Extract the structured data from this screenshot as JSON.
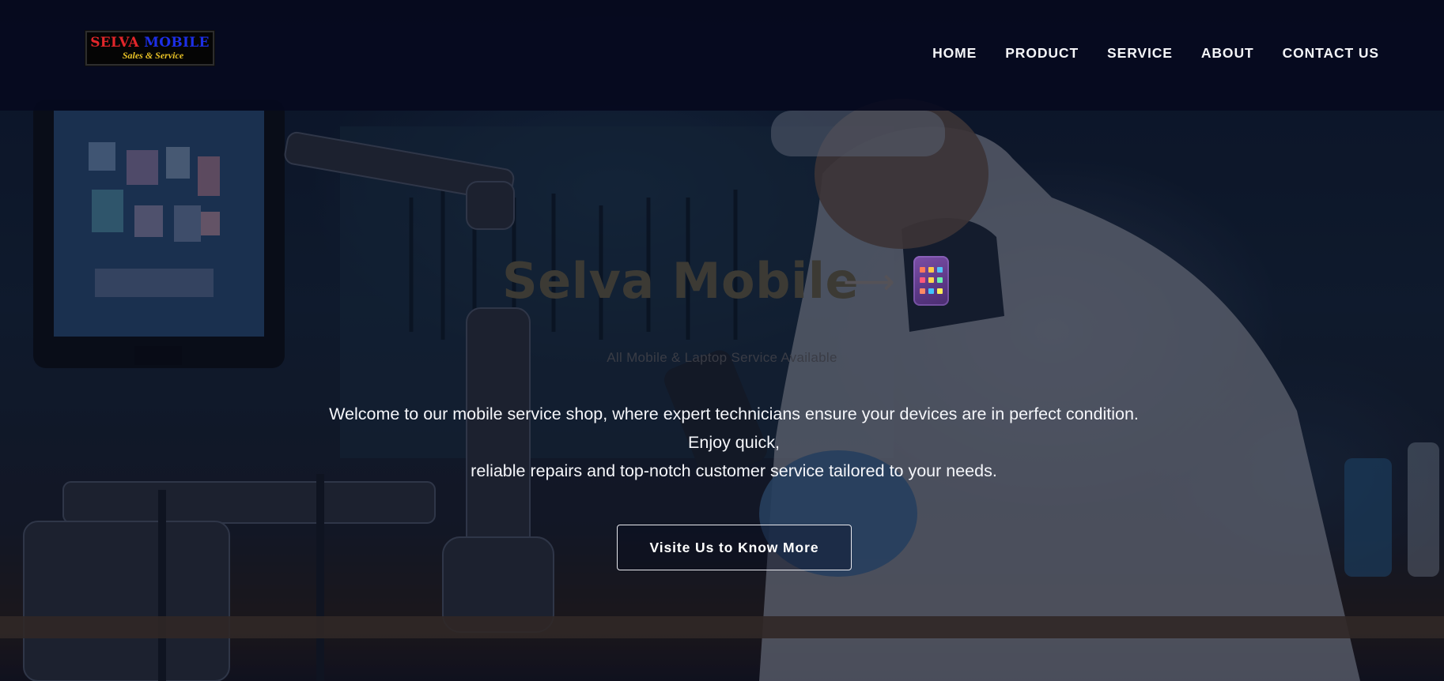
{
  "navbar": {
    "logo": {
      "line1_part1": "SELVA ",
      "line1_part2": "MOBILE",
      "line2": "Sales & Service",
      "colors": {
        "selva": "#e2262a",
        "mobile": "#1d2fe6",
        "tagline": "#e9c226"
      }
    },
    "links": [
      "HOME",
      "PRODUCT",
      "SERVICE",
      "ABOUT",
      "CONTACT US"
    ]
  },
  "hero": {
    "title": "Selva Mobile",
    "arrow": "⟶",
    "icon": "mobile-phone-icon",
    "subtitle": "All Mobile & Laptop Service Available",
    "description_line1": "Welcome to our mobile service shop, where expert technicians ensure your devices are in perfect condition. Enjoy quick,",
    "description_line2": "reliable repairs and top-notch customer service tailored to your needs.",
    "cta_label": "Visite Us to Know More"
  },
  "colors": {
    "navbar_bg": "#06091e",
    "overlay": "#060a1e",
    "title": "#3c3a34",
    "text": "#f5f6fa"
  }
}
